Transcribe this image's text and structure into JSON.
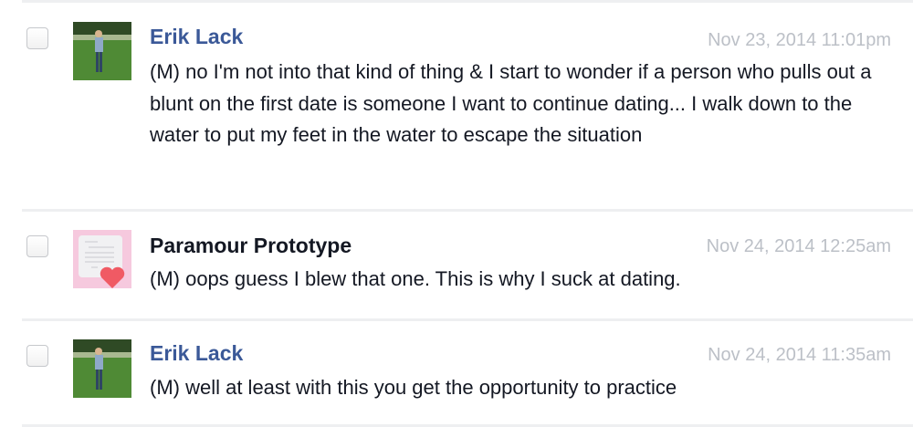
{
  "messages": [
    {
      "sender": "Erik Lack",
      "sender_style": "link",
      "avatar": "photo-man-in-park",
      "timestamp": "Nov 23, 2014 11:01pm",
      "text": "(M) no I'm not into that kind of thing & I start to wonder if a person who pulls out a blunt on the first date is someone I want to continue dating... I walk down to the water to put my feet in the water to escape the situation"
    },
    {
      "sender": "Paramour Prototype",
      "sender_style": "plain",
      "avatar": "love-letter-icon",
      "timestamp": "Nov 24, 2014 12:25am",
      "text": "(M) oops guess I blew that one. This is why I suck at dating."
    },
    {
      "sender": "Erik Lack",
      "sender_style": "link",
      "avatar": "photo-man-in-park",
      "timestamp": "Nov 24, 2014 11:35am",
      "text": "(M) well at least with this you get the opportunity to practice"
    }
  ],
  "colors": {
    "link": "#3b5998",
    "timestamp": "#bcc0c7",
    "text": "#141823",
    "avatar_pink": "#f6c9de",
    "heart": "#f05a64"
  }
}
